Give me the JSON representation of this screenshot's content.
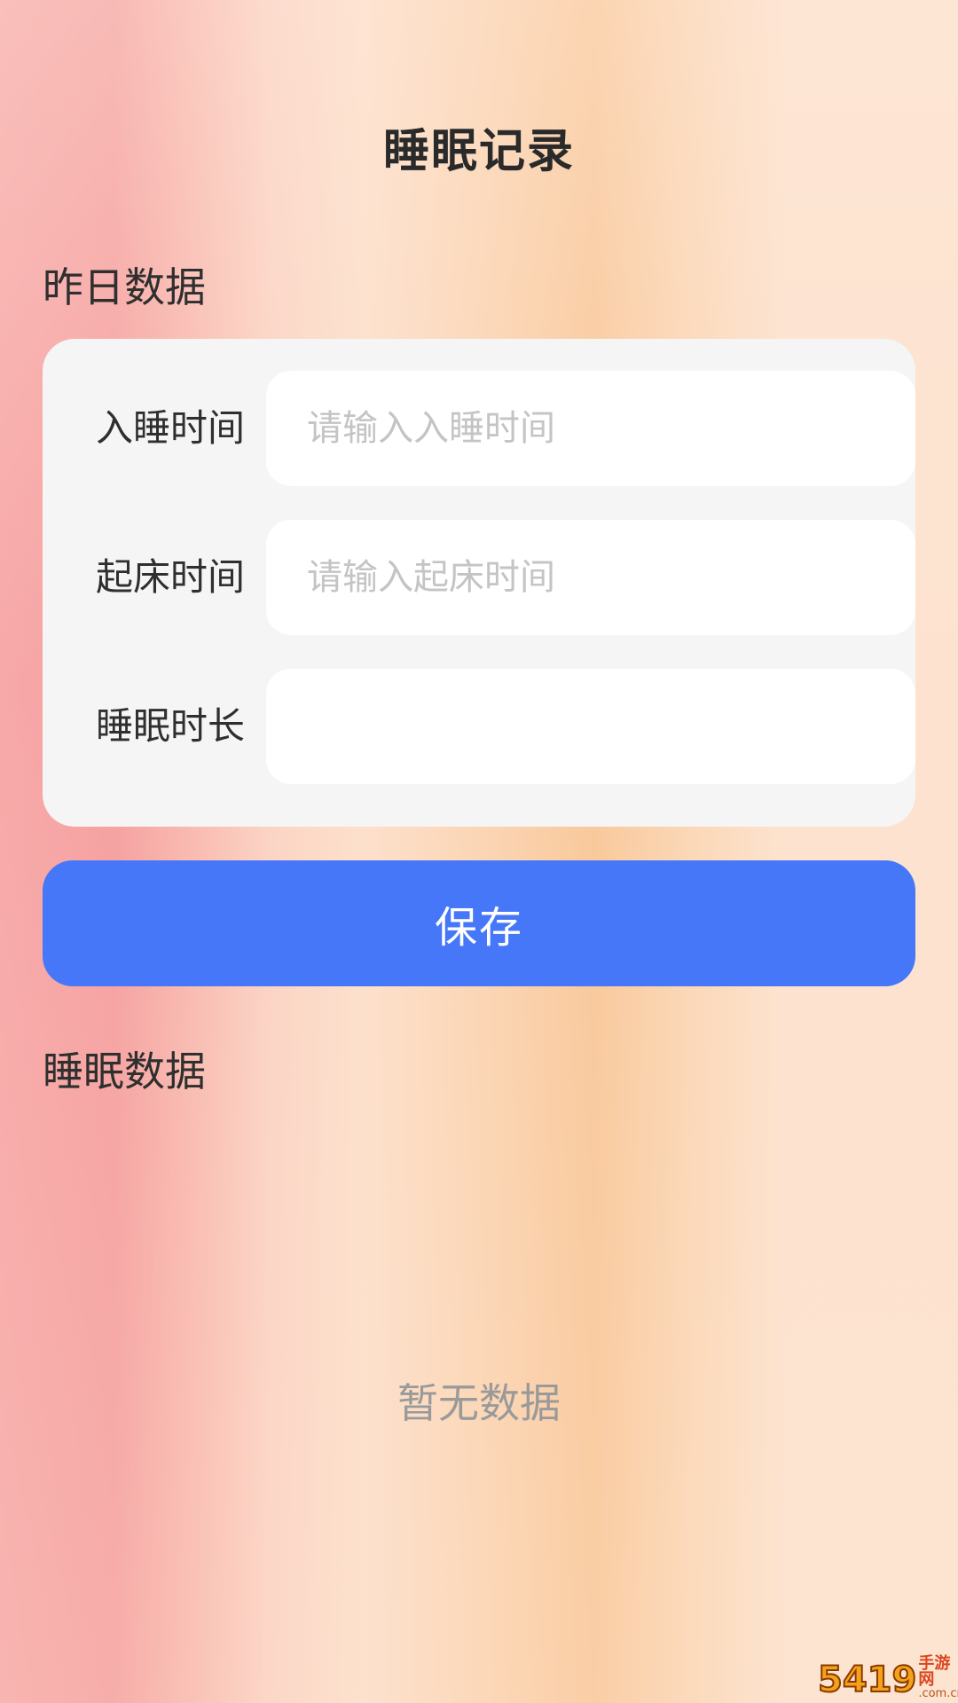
{
  "header": {
    "title": "睡眠记录"
  },
  "yesterday": {
    "section_label": "昨日数据",
    "fields": [
      {
        "label": "入睡时间",
        "placeholder": "请输入入睡时间",
        "value": ""
      },
      {
        "label": "起床时间",
        "placeholder": "请输入起床时间",
        "value": ""
      },
      {
        "label": "睡眠时长",
        "placeholder": "",
        "value": ""
      }
    ]
  },
  "actions": {
    "save_label": "保存"
  },
  "sleep_data": {
    "section_label": "睡眠数据",
    "empty_text": "暂无数据"
  },
  "watermark": {
    "number": "5419",
    "cn_text": "手游网",
    "domain": ".com.cn"
  },
  "colors": {
    "accent": "#4677f9",
    "card_bg": "#f6f5f5",
    "placeholder": "#c4c4c4"
  }
}
